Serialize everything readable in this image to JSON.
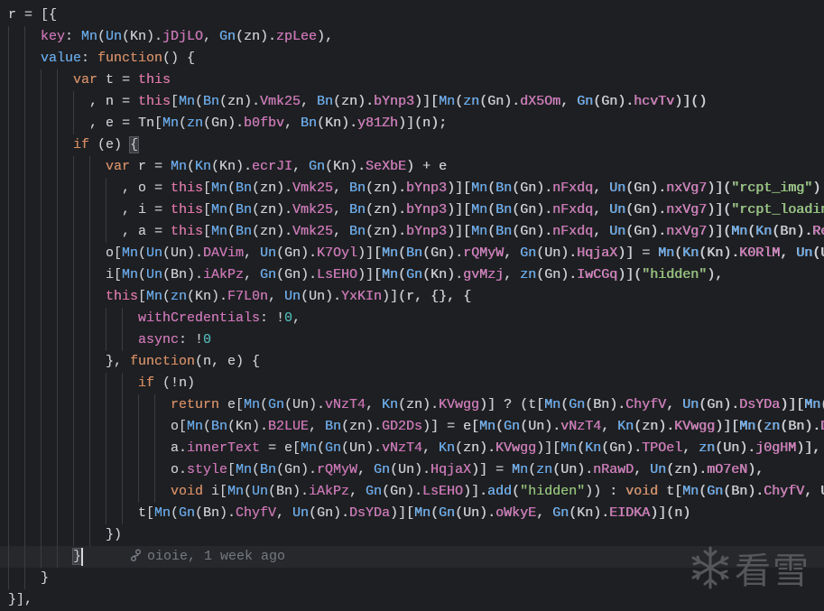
{
  "editor": {
    "lines": [
      "r = [{",
      "    key: Mn(Un(Kn).jDjLO, Gn(zn).zpLee),",
      "    value: function() {",
      "        var t = this",
      "          , n = this[Mn(Bn(zn).Vmk25, Bn(zn).bYnp3)][Mn(zn(Gn).dX5Om, Gn(Gn).hcvTv)]()",
      "          , e = Tn[Mn(zn(Gn).b0fbv, Bn(Kn).y81Zh)](n);",
      "        if (e) {",
      "            var r = Mn(Kn(Kn).ecrJI, Gn(Kn).SeXbE) + e",
      "              , o = this[Mn(Bn(zn).Vmk25, Bn(zn).bYnp3)][Mn(Bn(Gn).nFxdq, Un(Gn).nxVg7)](\"rcpt_img\")",
      "              , i = this[Mn(Bn(zn).Vmk25, Bn(zn).bYnp3)][Mn(Bn(Gn).nFxdq, Un(Gn).nxVg7)](\"rcpt_loadin",
      "              , a = this[Mn(Bn(zn).Vmk25, Bn(zn).bYnp3)][Mn(Bn(Gn).nFxdq, Un(Gn).nxVg7)](Mn(Kn(Bn).Re",
      "            o[Mn(Un(Un).DAVim, Un(Gn).K7Oyl)][Mn(Bn(Gn).rQMyW, Gn(Un).HqjaX)] = Mn(Kn(Kn).K0RlM, Un(Un",
      "            i[Mn(Un(Bn).iAkPz, Gn(Gn).LsEHO)][Mn(Gn(Kn).gvMzj, zn(Gn).IwCGq)](\"hidden\"),",
      "            this[Mn(zn(Kn).F7L0n, Un(Un).YxKIn)](r, {}, {",
      "                withCredentials: !0,",
      "                async: !0",
      "            }, function(n, e) {",
      "                if (!n)",
      "                    return e[Mn(Gn(Un).vNzT4, Kn(zn).KVwgg)] ? (t[Mn(Gn(Bn).ChyfV, Un(Gn).DsYDa)][Mn(",
      "                    o[Mn(Bn(Kn).B2LUE, Bn(zn).GD2Ds)] = e[Mn(Gn(Un).vNzT4, Kn(zn).KVwgg)][Mn(zn(Bn).D",
      "                    a.innerText = e[Mn(Gn(Un).vNzT4, Kn(zn).KVwgg)][Mn(Kn(Gn).TPOel, zn(Un).j0gHM)],",
      "                    o.style[Mn(Bn(Gn).rQMyW, Gn(Un).HqjaX)] = Mn(zn(Un).nRawD, Un(zn).mO7eN),",
      "                    void i[Mn(Un(Bn).iAkPz, Gn(Gn).LsEHO)].add(\"hidden\")) : void t[Mn(Gn(Bn).ChyfV, U",
      "                t[Mn(Gn(Bn).ChyfV, Un(Gn).DsYDa)][Mn(Gn(Un).oWkyE, Gn(Kn).EIDKA)](n)",
      "            })",
      "        }",
      "    }",
      "}],"
    ],
    "current_line": 25,
    "blame": {
      "icon": "git-commit-icon",
      "text": "oioie, 1 week ago"
    }
  },
  "watermark": {
    "icon": "snowflake-icon",
    "text": "看雪"
  },
  "colors": {
    "background": "#1e1f22",
    "keyword": "#d9895b",
    "function": "#5ea8f0",
    "property": "#cf6eb6",
    "string": "#8cc36e",
    "number": "#3fb5b3"
  }
}
